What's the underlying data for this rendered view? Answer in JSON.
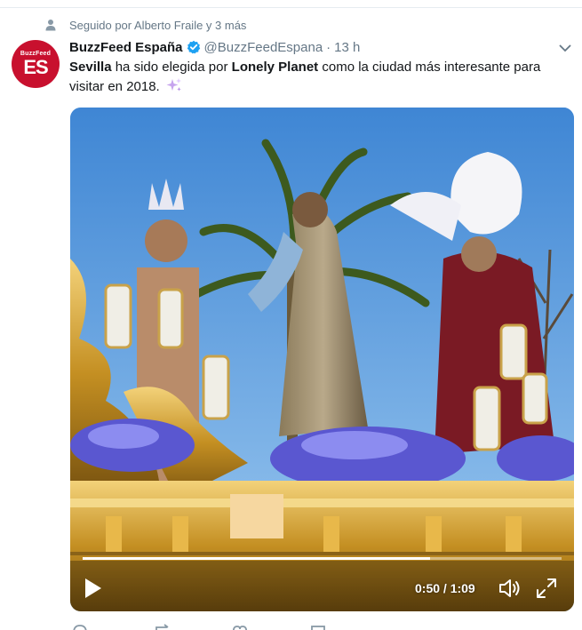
{
  "social_context": {
    "text": "Seguido por Alberto Fraile y 3 más",
    "icon": "person-icon"
  },
  "author": {
    "avatar_small": "BuzzFeed",
    "avatar_big": "ES",
    "avatar_color": "#c8102e",
    "name": "BuzzFeed España",
    "handle": "@BuzzFeedEspana",
    "separator": "·",
    "time": "13 h",
    "verified_color": "#1da1f2"
  },
  "tweet": {
    "bold_1": "Sevilla",
    "text_1": " ha sido elegida por ",
    "bold_2": "Lonely Planet",
    "text_2": " como la ciudad más interesante para visitar en 2018.",
    "emoji": "sparkles-icon"
  },
  "video": {
    "time_display": "0:50 / 1:09",
    "progress": 0.725
  },
  "actions": [
    "reply-icon",
    "retweet-icon",
    "like-icon",
    "message-icon"
  ]
}
